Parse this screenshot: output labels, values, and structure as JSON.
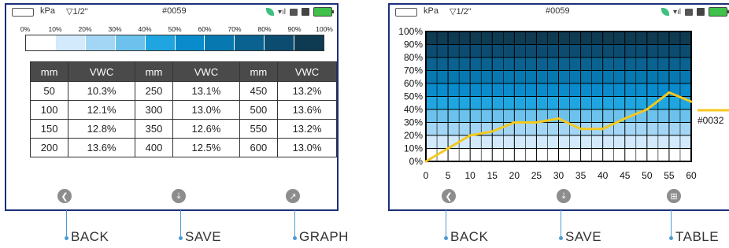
{
  "status": {
    "unit": "kPa",
    "pipe": "▽1/2\"",
    "device_id": "#0059"
  },
  "left": {
    "scale_labels": [
      "0%",
      "10%",
      "20%",
      "30%",
      "40%",
      "50%",
      "60%",
      "70%",
      "80%",
      "90%",
      "100%"
    ],
    "scale_colors": [
      "#ffffff",
      "#d2eafb",
      "#a3d6f4",
      "#6cc2ec",
      "#1fa6e0",
      "#0a8ccc",
      "#0878b0",
      "#0a6290",
      "#0b4c70",
      "#0e3a52"
    ],
    "table": {
      "headers": [
        "mm",
        "VWC",
        "mm",
        "VWC",
        "mm",
        "VWC"
      ],
      "rows": [
        [
          "50",
          "10.3%",
          "250",
          "13.1%",
          "450",
          "13.2%"
        ],
        [
          "100",
          "12.1%",
          "300",
          "13.0%",
          "500",
          "13.6%"
        ],
        [
          "150",
          "12.8%",
          "350",
          "12.6%",
          "550",
          "13.2%"
        ],
        [
          "200",
          "13.6%",
          "400",
          "12.5%",
          "600",
          "13.0%"
        ]
      ]
    },
    "buttons": {
      "back": "BACK",
      "save": "SAVE",
      "graph": "GRAPH"
    }
  },
  "right": {
    "buttons": {
      "back": "BACK",
      "save": "SAVE",
      "table": "TABLE"
    },
    "legend": "#0032"
  },
  "chart_data": {
    "type": "line",
    "x": [
      0,
      5,
      10,
      15,
      20,
      25,
      30,
      35,
      40,
      45,
      50,
      55,
      60
    ],
    "series": [
      {
        "name": "#0032",
        "color": "#f4c81e",
        "values": [
          0,
          10,
          20,
          23,
          30,
          30,
          33,
          25,
          25,
          33,
          40,
          53,
          46
        ]
      }
    ],
    "yticks": [
      "0%",
      "10%",
      "20%",
      "30%",
      "40%",
      "50%",
      "60%",
      "70%",
      "80%",
      "90%",
      "100%"
    ],
    "xticks": [
      "0",
      "5",
      "10",
      "15",
      "20",
      "25",
      "30",
      "35",
      "40",
      "45",
      "50",
      "55",
      "60"
    ],
    "xlim": [
      0,
      60
    ],
    "ylim": [
      0,
      100
    ],
    "band_colors": [
      "#ffffff",
      "#d2eafb",
      "#a3d6f4",
      "#6cc2ec",
      "#1fa6e0",
      "#0a8ccc",
      "#0878b0",
      "#0a6290",
      "#0b4c70",
      "#0e3a52"
    ],
    "grid": true
  }
}
